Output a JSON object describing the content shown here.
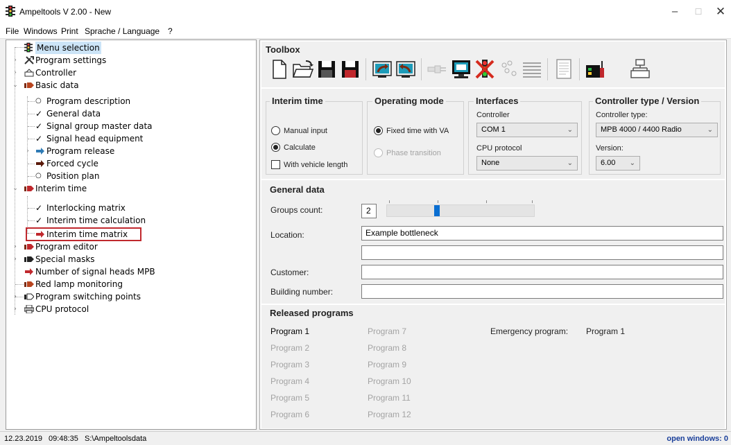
{
  "window": {
    "title": "Ampeltools V 2.00 - New",
    "minimize": "–",
    "maximize": "☐",
    "close": "✕"
  },
  "menu": [
    "File",
    "Windows",
    "Print",
    "Sprache / Language",
    "?"
  ],
  "tree": {
    "items": [
      {
        "label": "Menu selection",
        "icon": "traffic-light-icon"
      },
      {
        "label": "Program settings",
        "icon": "tools-icon"
      },
      {
        "label": "Controller",
        "icon": "controller-icon"
      },
      {
        "label": "Basic data",
        "icon": "folder-arrow-icon"
      },
      {
        "label": "Program description",
        "icon": "circle-bullet-icon"
      },
      {
        "label": "General data",
        "icon": "checkmark-icon"
      },
      {
        "label": "Signal group master data",
        "icon": "checkmark-icon"
      },
      {
        "label": "Signal head equipment",
        "icon": "checkmark-icon"
      },
      {
        "label": "Program release",
        "icon": "arrow-icon"
      },
      {
        "label": "Forced cycle",
        "icon": "arrow-icon"
      },
      {
        "label": "Position plan",
        "icon": "circle-bullet-icon"
      },
      {
        "label": "Interim time",
        "icon": "folder-arrow-icon"
      },
      {
        "label": "Interlocking matrix",
        "icon": "checkmark-icon"
      },
      {
        "label": "Interim time calculation",
        "icon": "checkmark-icon"
      },
      {
        "label": "Interim time matrix",
        "icon": "arrow-icon"
      },
      {
        "label": "Program editor",
        "icon": "folder-arrow-icon"
      },
      {
        "label": "Special masks",
        "icon": "folder-arrow-icon"
      },
      {
        "label": "Number of signal heads MPB",
        "icon": "arrow-icon"
      },
      {
        "label": "Red lamp monitoring",
        "icon": "folder-arrow-icon"
      },
      {
        "label": "Program switching points",
        "icon": "folder-arrow-icon"
      },
      {
        "label": "CPU protocol",
        "icon": "printer-icon"
      }
    ]
  },
  "toolbox": {
    "title": "Toolbox",
    "buttons": [
      "new-file-icon",
      "open-folder-icon",
      "save-icon",
      "save-as-icon",
      "upload-icon",
      "download-icon",
      "connection-icon",
      "monitor-icon",
      "disconnect-icon",
      "nodes-icon",
      "list-icon",
      "report-icon",
      "device-icon",
      "network-icon"
    ]
  },
  "interim": {
    "title": "Interim time",
    "manual": "Manual input",
    "calculate": "Calculate",
    "vehicle": "With vehicle length"
  },
  "operating": {
    "title": "Operating mode",
    "fixed": "Fixed time with VA",
    "phase": "Phase transition"
  },
  "interfaces": {
    "title": "Interfaces",
    "controller_label": "Controller",
    "controller_value": "COM 1",
    "cpu_label": "CPU protocol",
    "cpu_value": "None"
  },
  "ctrltype": {
    "title": "Controller type / Version",
    "type_label": "Controller type:",
    "type_value": "MPB 4000 / 4400 Radio",
    "version_label": "Version:",
    "version_value": "6.00"
  },
  "general": {
    "title": "General data",
    "groups_label": "Groups count:",
    "groups_value": "2",
    "groups_slider_fraction": 0.33,
    "location_label": "Location:",
    "location_value": "Example bottleneck",
    "location2_value": "",
    "customer_label": "Customer:",
    "customer_value": "",
    "building_label": "Building number:",
    "building_value": ""
  },
  "released": {
    "title": "Released programs",
    "col1": [
      "Program 1",
      "Program 2",
      "Program 3",
      "Program 4",
      "Program 5",
      "Program 6"
    ],
    "col2": [
      "Program 7",
      "Program 8",
      "Program 9",
      "Program 10",
      "Program 11",
      "Program 12"
    ],
    "emergency_label": "Emergency program:",
    "emergency_value": "Program 1"
  },
  "status": {
    "date": "12.23.2019",
    "time": "09:48:35",
    "path": "S:\\Ampeltoolsdata",
    "open_windows": "open windows: 0"
  },
  "colors": {
    "accent": "#0a6ed1",
    "highlight_box": "#c0282d",
    "selection": "#cce4f7",
    "status_text": "#1a3f9a"
  }
}
